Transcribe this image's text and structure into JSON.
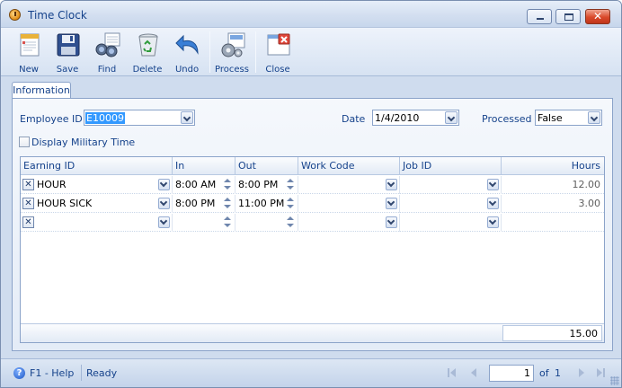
{
  "window": {
    "title": "Time Clock"
  },
  "toolbar": {
    "new": "New",
    "save": "Save",
    "find": "Find",
    "delete": "Delete",
    "undo": "Undo",
    "process": "Process",
    "close": "Close"
  },
  "tabs": [
    {
      "label": "Information"
    }
  ],
  "form": {
    "employee_id_label": "Employee ID",
    "employee_id": "E10009",
    "date_label": "Date",
    "date": "1/4/2010",
    "processed_label": "Processed",
    "processed": "False",
    "military_time_label": "Display Military Time",
    "military_time_checked": false
  },
  "grid": {
    "columns": [
      "Earning ID",
      "In",
      "Out",
      "Work Code",
      "Job ID",
      "Hours"
    ],
    "rows": [
      {
        "earning_id": "HOUR",
        "in": "8:00 AM",
        "out": "8:00 PM",
        "work_code": "",
        "job_id": "",
        "hours": "12.00"
      },
      {
        "earning_id": "HOUR SICK",
        "in": "8:00 PM",
        "out": "11:00 PM",
        "work_code": "",
        "job_id": "",
        "hours": "3.00"
      },
      {
        "earning_id": "",
        "in": "",
        "out": "",
        "work_code": "",
        "job_id": "",
        "hours": ""
      }
    ],
    "total_hours": "15.00"
  },
  "status": {
    "help": "F1 - Help",
    "state": "Ready",
    "page": "1",
    "of_label": "of",
    "page_count": "1"
  }
}
